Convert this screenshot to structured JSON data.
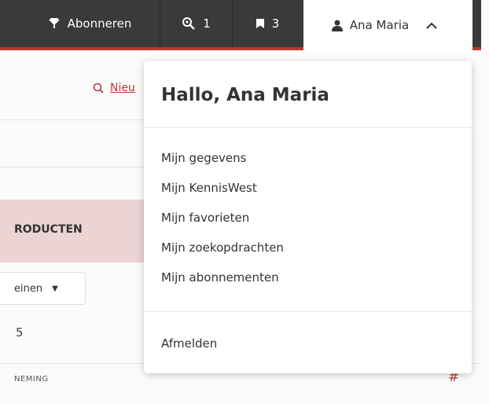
{
  "topbar": {
    "subscribe_label": "Abonneren",
    "search_count": "1",
    "saved_count": "3",
    "user_name": "Ana Maria"
  },
  "background": {
    "search_link": "Nieu",
    "products_heading": "RODUCTEN",
    "filter_label": "einen",
    "count": "5",
    "column_header": "NEMING",
    "hash": "#"
  },
  "dropdown": {
    "greeting": "Hallo, Ana Maria",
    "items": [
      "Mijn gegevens",
      "Mijn KennisWest",
      "Mijn favorieten",
      "Mijn zoekopdrachten",
      "Mijn abonnementen"
    ],
    "logout": "Afmelden"
  },
  "colors": {
    "topbar_bg": "#3a3a3a",
    "accent": "#b83a30",
    "products_bg": "#ecd4d4"
  }
}
